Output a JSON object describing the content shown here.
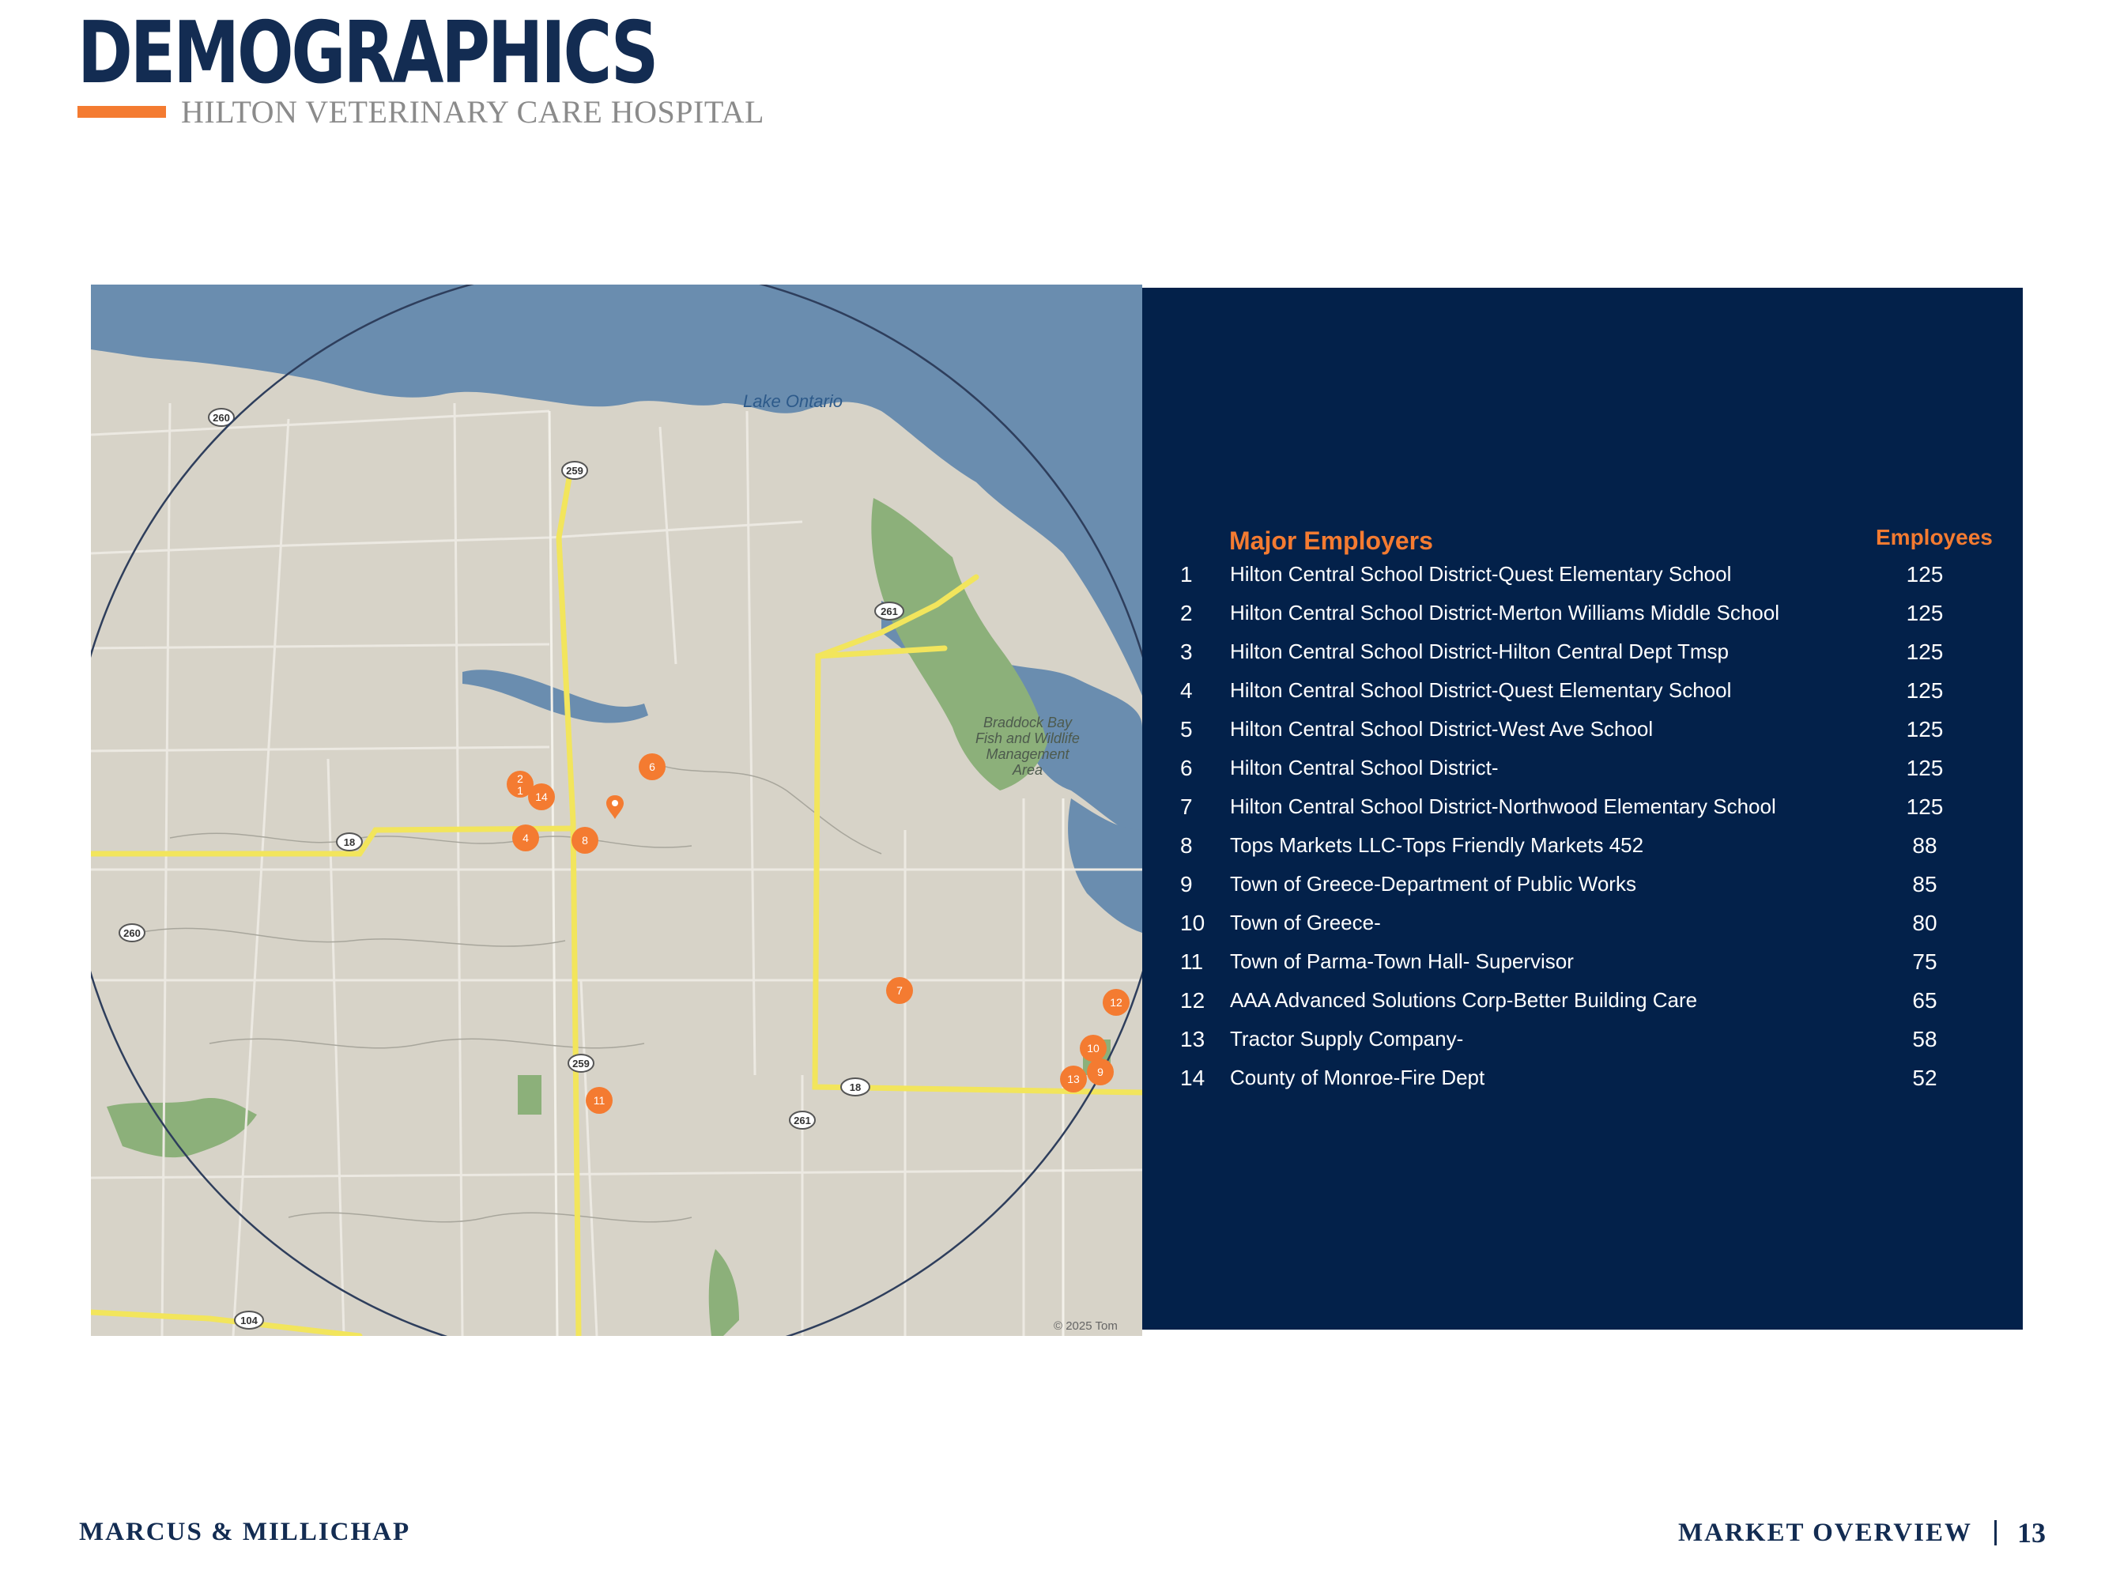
{
  "header": {
    "title": "DEMOGRAPHICS",
    "subtitle": "HILTON VETERINARY CARE HOSPITAL",
    "accent_color": "#f47b31",
    "title_color": "#132c52"
  },
  "map": {
    "lake_label": "Lake Ontario",
    "area_label": [
      "Braddock Bay",
      "Fish and Wildlife",
      "Management",
      "Area"
    ],
    "copyright": "© 2025 Tom",
    "marker_color": "#f47b31",
    "road_badges": [
      "260",
      "259",
      "261",
      "18",
      "260",
      "259",
      "18",
      "261",
      "104"
    ],
    "markers": [
      "2",
      "1",
      "14",
      "6",
      "4",
      "8",
      "7",
      "12",
      "10",
      "9",
      "13",
      "11"
    ]
  },
  "employers": {
    "header_name": "Major Employers",
    "header_count": "Employees",
    "rows": [
      {
        "rank": "1",
        "name": "Hilton Central School District-Quest Elementary School",
        "employees": "125"
      },
      {
        "rank": "2",
        "name": "Hilton Central School District-Merton Williams Middle School",
        "employees": "125"
      },
      {
        "rank": "3",
        "name": "Hilton Central School District-Hilton Central Dept Tmsp",
        "employees": "125"
      },
      {
        "rank": "4",
        "name": "Hilton Central School District-Quest Elementary School",
        "employees": "125"
      },
      {
        "rank": "5",
        "name": "Hilton Central School District-West Ave School",
        "employees": "125"
      },
      {
        "rank": "6",
        "name": "Hilton Central School District-",
        "employees": "125"
      },
      {
        "rank": "7",
        "name": "Hilton Central School District-Northwood Elementary School",
        "employees": "125"
      },
      {
        "rank": "8",
        "name": "Tops Markets LLC-Tops Friendly Markets 452",
        "employees": "88"
      },
      {
        "rank": "9",
        "name": "Town of Greece-Department of Public Works",
        "employees": "85"
      },
      {
        "rank": "10",
        "name": "Town of Greece-",
        "employees": "80"
      },
      {
        "rank": "11",
        "name": "Town of Parma-Town Hall- Supervisor",
        "employees": "75"
      },
      {
        "rank": "12",
        "name": "AAA Advanced Solutions Corp-Better Building Care",
        "employees": "65"
      },
      {
        "rank": "13",
        "name": "Tractor Supply Company-",
        "employees": "58"
      },
      {
        "rank": "14",
        "name": "County of Monroe-Fire Dept",
        "employees": "52"
      }
    ]
  },
  "footer": {
    "brand": "MARCUS & MILLICHAP",
    "section": "MARKET OVERVIEW",
    "page": "13"
  }
}
